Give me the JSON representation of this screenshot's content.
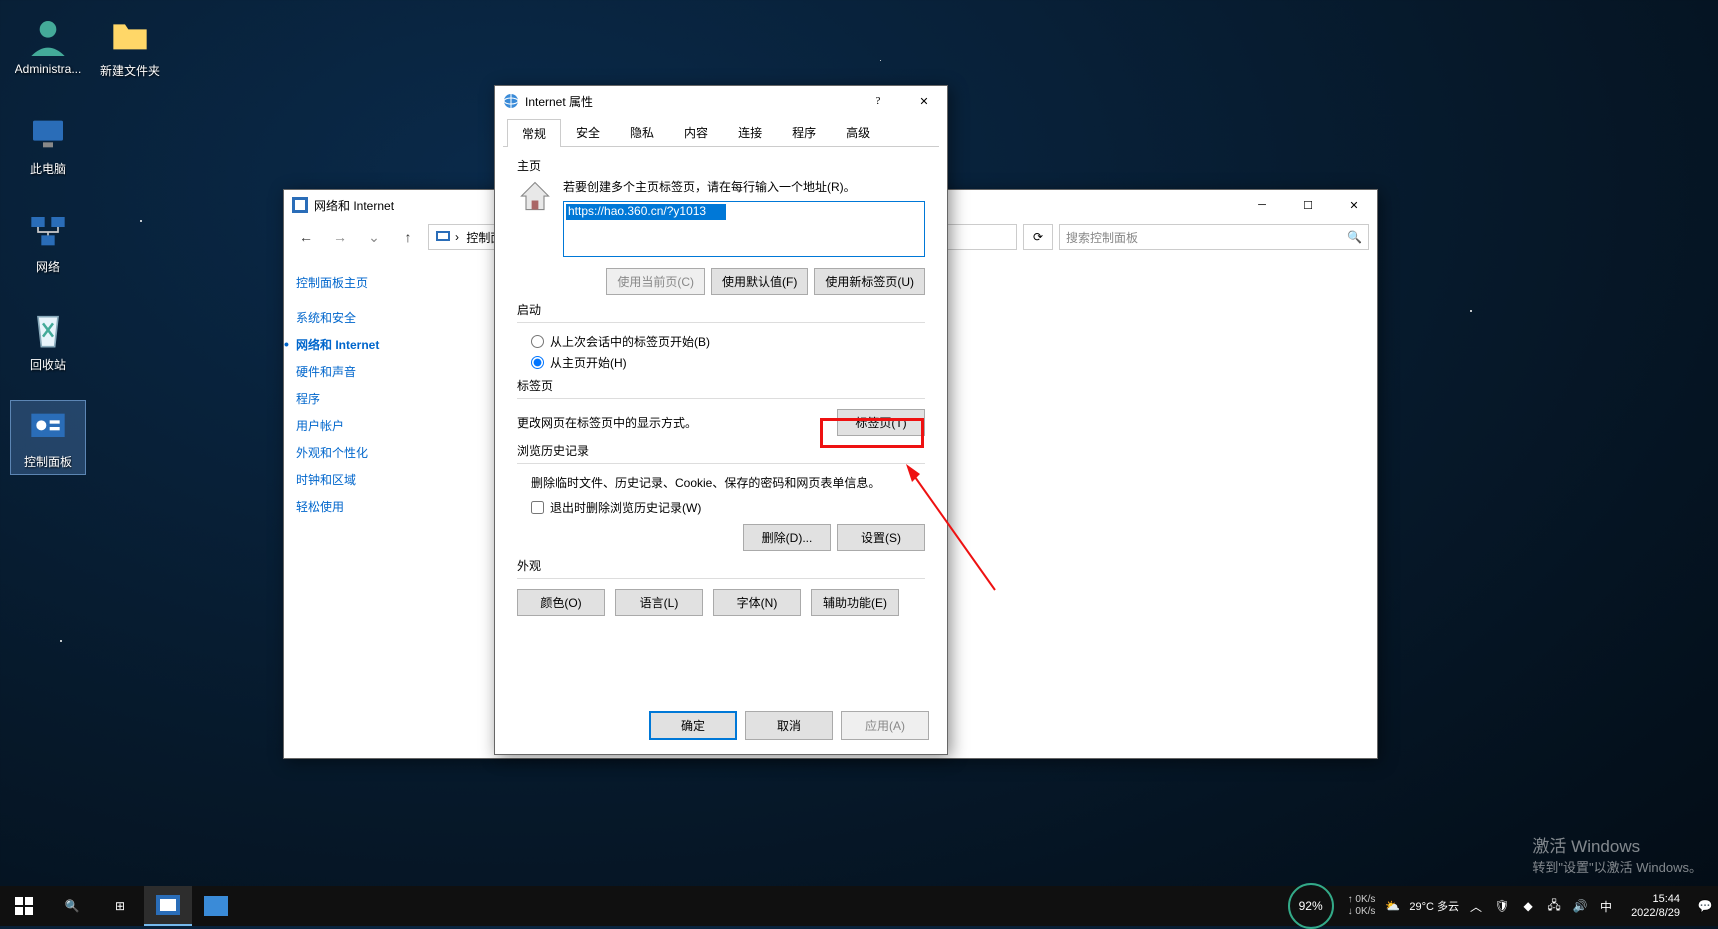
{
  "desktop_icons": {
    "admin": "Administra...",
    "newfolder": "新建文件夹",
    "thispc": "此电脑",
    "network": "网络",
    "recycle": "回收站",
    "ctrlpanel": "控制面板"
  },
  "ctrlpanel": {
    "title": "网络和 Internet",
    "breadcrumb": {
      "root": "控制面板",
      "sep": "›"
    },
    "search_placeholder": "搜索控制面板",
    "sidebar_main": "控制面板主页",
    "categories": [
      "系统和安全",
      "网络和 Internet",
      "硬件和声音",
      "程序",
      "用户帐户",
      "外观和个性化",
      "时钟和区域",
      "轻松使用"
    ],
    "active_index": 1
  },
  "dialog": {
    "title": "Internet 属性",
    "tabs": [
      "常规",
      "安全",
      "隐私",
      "内容",
      "连接",
      "程序",
      "高级"
    ],
    "active_tab": 0,
    "homepage": {
      "label": "主页",
      "hint": "若要创建多个主页标签页，请在每行输入一个地址(R)。",
      "url": "https://hao.360.cn/?y1013",
      "btn_current": "使用当前页(C)",
      "btn_default": "使用默认值(F)",
      "btn_newtab": "使用新标签页(U)"
    },
    "startup": {
      "label": "启动",
      "opt_last": "从上次会话中的标签页开始(B)",
      "opt_home": "从主页开始(H)"
    },
    "tabs_section": {
      "label": "标签页",
      "desc": "更改网页在标签页中的显示方式。",
      "btn": "标签页(T)"
    },
    "history": {
      "label": "浏览历史记录",
      "desc": "删除临时文件、历史记录、Cookie、保存的密码和网页表单信息。",
      "check": "退出时删除浏览历史记录(W)",
      "btn_delete": "删除(D)...",
      "btn_settings": "设置(S)"
    },
    "appearance": {
      "label": "外观",
      "btn_colors": "颜色(O)",
      "btn_lang": "语言(L)",
      "btn_fonts": "字体(N)",
      "btn_access": "辅助功能(E)"
    },
    "bottom": {
      "ok": "确定",
      "cancel": "取消",
      "apply": "应用(A)"
    }
  },
  "taskbar": {
    "perf": "92%",
    "net_up": "0K/s",
    "net_down": "0K/s",
    "weather": "29°C 多云",
    "ime": "中",
    "time": "15:44",
    "date": "2022/8/29"
  },
  "watermark": {
    "title": "激活 Windows",
    "sub": "转到\"设置\"以激活 Windows。"
  },
  "colors": {
    "accent": "#0078d7",
    "highlight": "#e11"
  }
}
